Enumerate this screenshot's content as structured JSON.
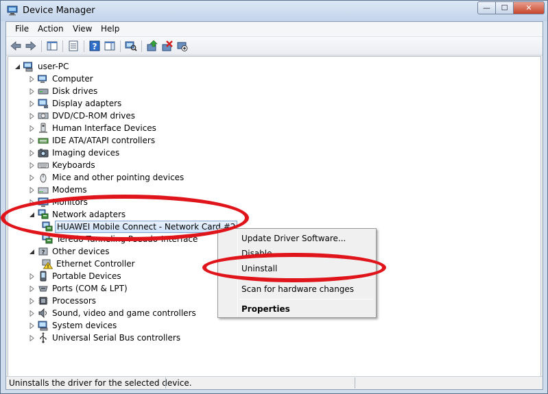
{
  "window": {
    "title": "Device Manager",
    "min_glyph": "—",
    "max_glyph": "☐",
    "close_glyph": "✕"
  },
  "menu": [
    "File",
    "Action",
    "View",
    "Help"
  ],
  "toolbar": {
    "icons": [
      "back-icon",
      "forward-icon",
      "show-hide-console-tree-icon",
      "properties-icon",
      "help-icon",
      "action-pane-icon",
      "scan-hardware-icon",
      "update-driver-icon",
      "uninstall-icon",
      "disable-icon"
    ]
  },
  "tree": {
    "root": "user-PC",
    "items": [
      {
        "label": "Computer",
        "icon": "computer-icon"
      },
      {
        "label": "Disk drives",
        "icon": "disk-drive-icon"
      },
      {
        "label": "Display adapters",
        "icon": "display-adapter-icon"
      },
      {
        "label": "DVD/CD-ROM drives",
        "icon": "dvd-drive-icon"
      },
      {
        "label": "Human Interface Devices",
        "icon": "hid-icon"
      },
      {
        "label": "IDE ATA/ATAPI controllers",
        "icon": "ide-controller-icon"
      },
      {
        "label": "Imaging devices",
        "icon": "camera-icon"
      },
      {
        "label": "Keyboards",
        "icon": "keyboard-icon"
      },
      {
        "label": "Mice and other pointing devices",
        "icon": "mouse-icon"
      },
      {
        "label": "Modems",
        "icon": "modem-icon"
      },
      {
        "label": "Monitors",
        "icon": "monitor-icon"
      },
      {
        "label": "Network adapters",
        "icon": "network-adapter-icon",
        "expanded": true
      },
      {
        "label": "HUAWEI Mobile Connect - Network Card #2",
        "icon": "network-adapter-icon",
        "child": true,
        "selected": true
      },
      {
        "label": "Teredo Tunneling Pseudo-Interface",
        "icon": "network-adapter-icon",
        "child": true
      },
      {
        "label": "Other devices",
        "icon": "other-device-icon",
        "expanded": true
      },
      {
        "label": "Ethernet Controller",
        "icon": "warning-device-icon",
        "child": true
      },
      {
        "label": "Portable Devices",
        "icon": "portable-device-icon"
      },
      {
        "label": "Ports (COM & LPT)",
        "icon": "port-icon"
      },
      {
        "label": "Processors",
        "icon": "processor-icon"
      },
      {
        "label": "Sound, video and game controllers",
        "icon": "sound-icon"
      },
      {
        "label": "System devices",
        "icon": "system-device-icon"
      },
      {
        "label": "Universal Serial Bus controllers",
        "icon": "usb-icon"
      }
    ]
  },
  "context_menu": {
    "items": [
      "Update Driver Software...",
      "Disable",
      "Uninstall",
      "Scan for hardware changes",
      "Properties"
    ]
  },
  "status": {
    "text": "Uninstalls the driver for the selected device."
  },
  "colors": {
    "annotation_red": "#e0151b",
    "selection": "#cfe3fb"
  }
}
